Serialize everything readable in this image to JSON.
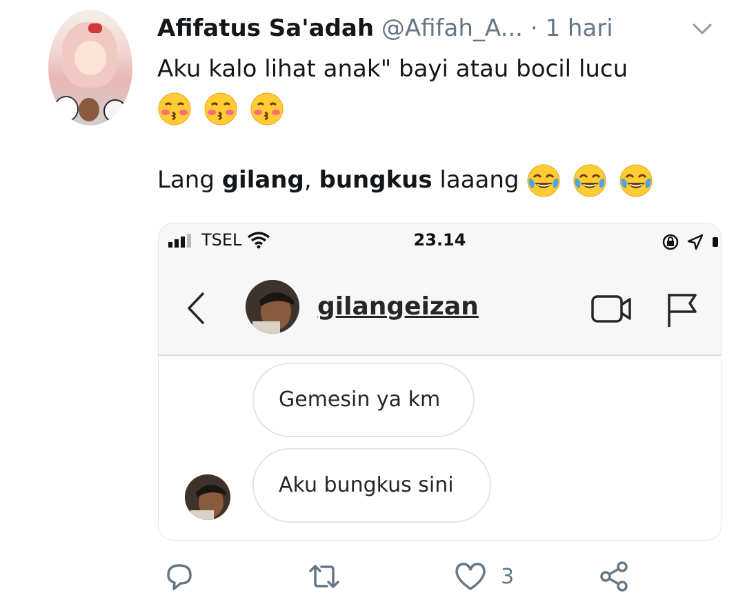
{
  "tweet": {
    "author_name": "Afifatus Sa'adah",
    "handle": "@Afifah_A...",
    "separator": "·",
    "time": "1 hari",
    "line1": "Aku kalo lihat anak\" bayi atau bocil lucu",
    "line2_emojis": [
      "kissing-blush-emoji",
      "kissing-blush-emoji",
      "kissing-blush-emoji"
    ],
    "line3_prefix": "Lang ",
    "line3_bold1": "gilang",
    "line3_mid": ", ",
    "line3_bold2": "bungkus",
    "line3_suffix": " laaang",
    "line3_emojis": [
      "tears-of-joy-emoji",
      "tears-of-joy-emoji",
      "tears-of-joy-emoji"
    ]
  },
  "screenshot": {
    "carrier": "TSEL",
    "clock": "23.14",
    "username": "gilangeizan",
    "messages": [
      {
        "text": "Gemesin ya km"
      },
      {
        "text": "Aku bungkus sini"
      }
    ]
  },
  "actions": {
    "reply_icon": "reply-icon",
    "retweet_icon": "retweet-icon",
    "like_icon": "heart-icon",
    "like_count": "3",
    "share_icon": "share-icon"
  },
  "colors": {
    "text": "#14171a",
    "muted": "#657786",
    "border": "#e1e8ed"
  }
}
